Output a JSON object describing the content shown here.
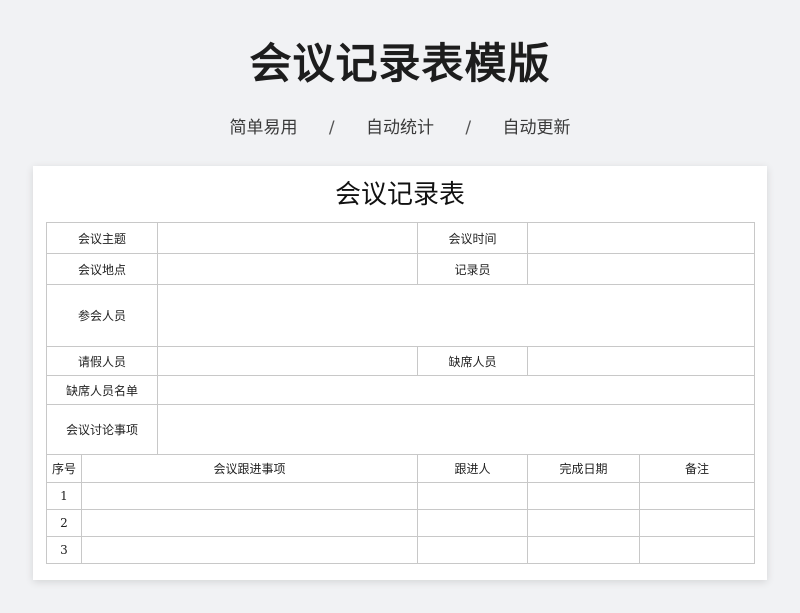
{
  "header": {
    "title": "会议记录表模版",
    "tags": [
      "简单易用",
      "自动统计",
      "自动更新"
    ],
    "separator": "/"
  },
  "sheet": {
    "title": "会议记录表",
    "fields": {
      "topic": "会议主题",
      "time": "会议时间",
      "location": "会议地点",
      "recorder": "记录员",
      "attendees": "参会人员",
      "leave": "请假人员",
      "absent": "缺席人员",
      "absent_list": "缺席人员名单",
      "discussion": "会议讨论事项"
    },
    "followup": {
      "columns": [
        "序号",
        "会议跟进事项",
        "跟进人",
        "完成日期",
        "备注"
      ],
      "rows": [
        {
          "no": "1"
        },
        {
          "no": "2"
        },
        {
          "no": "3"
        }
      ]
    }
  }
}
